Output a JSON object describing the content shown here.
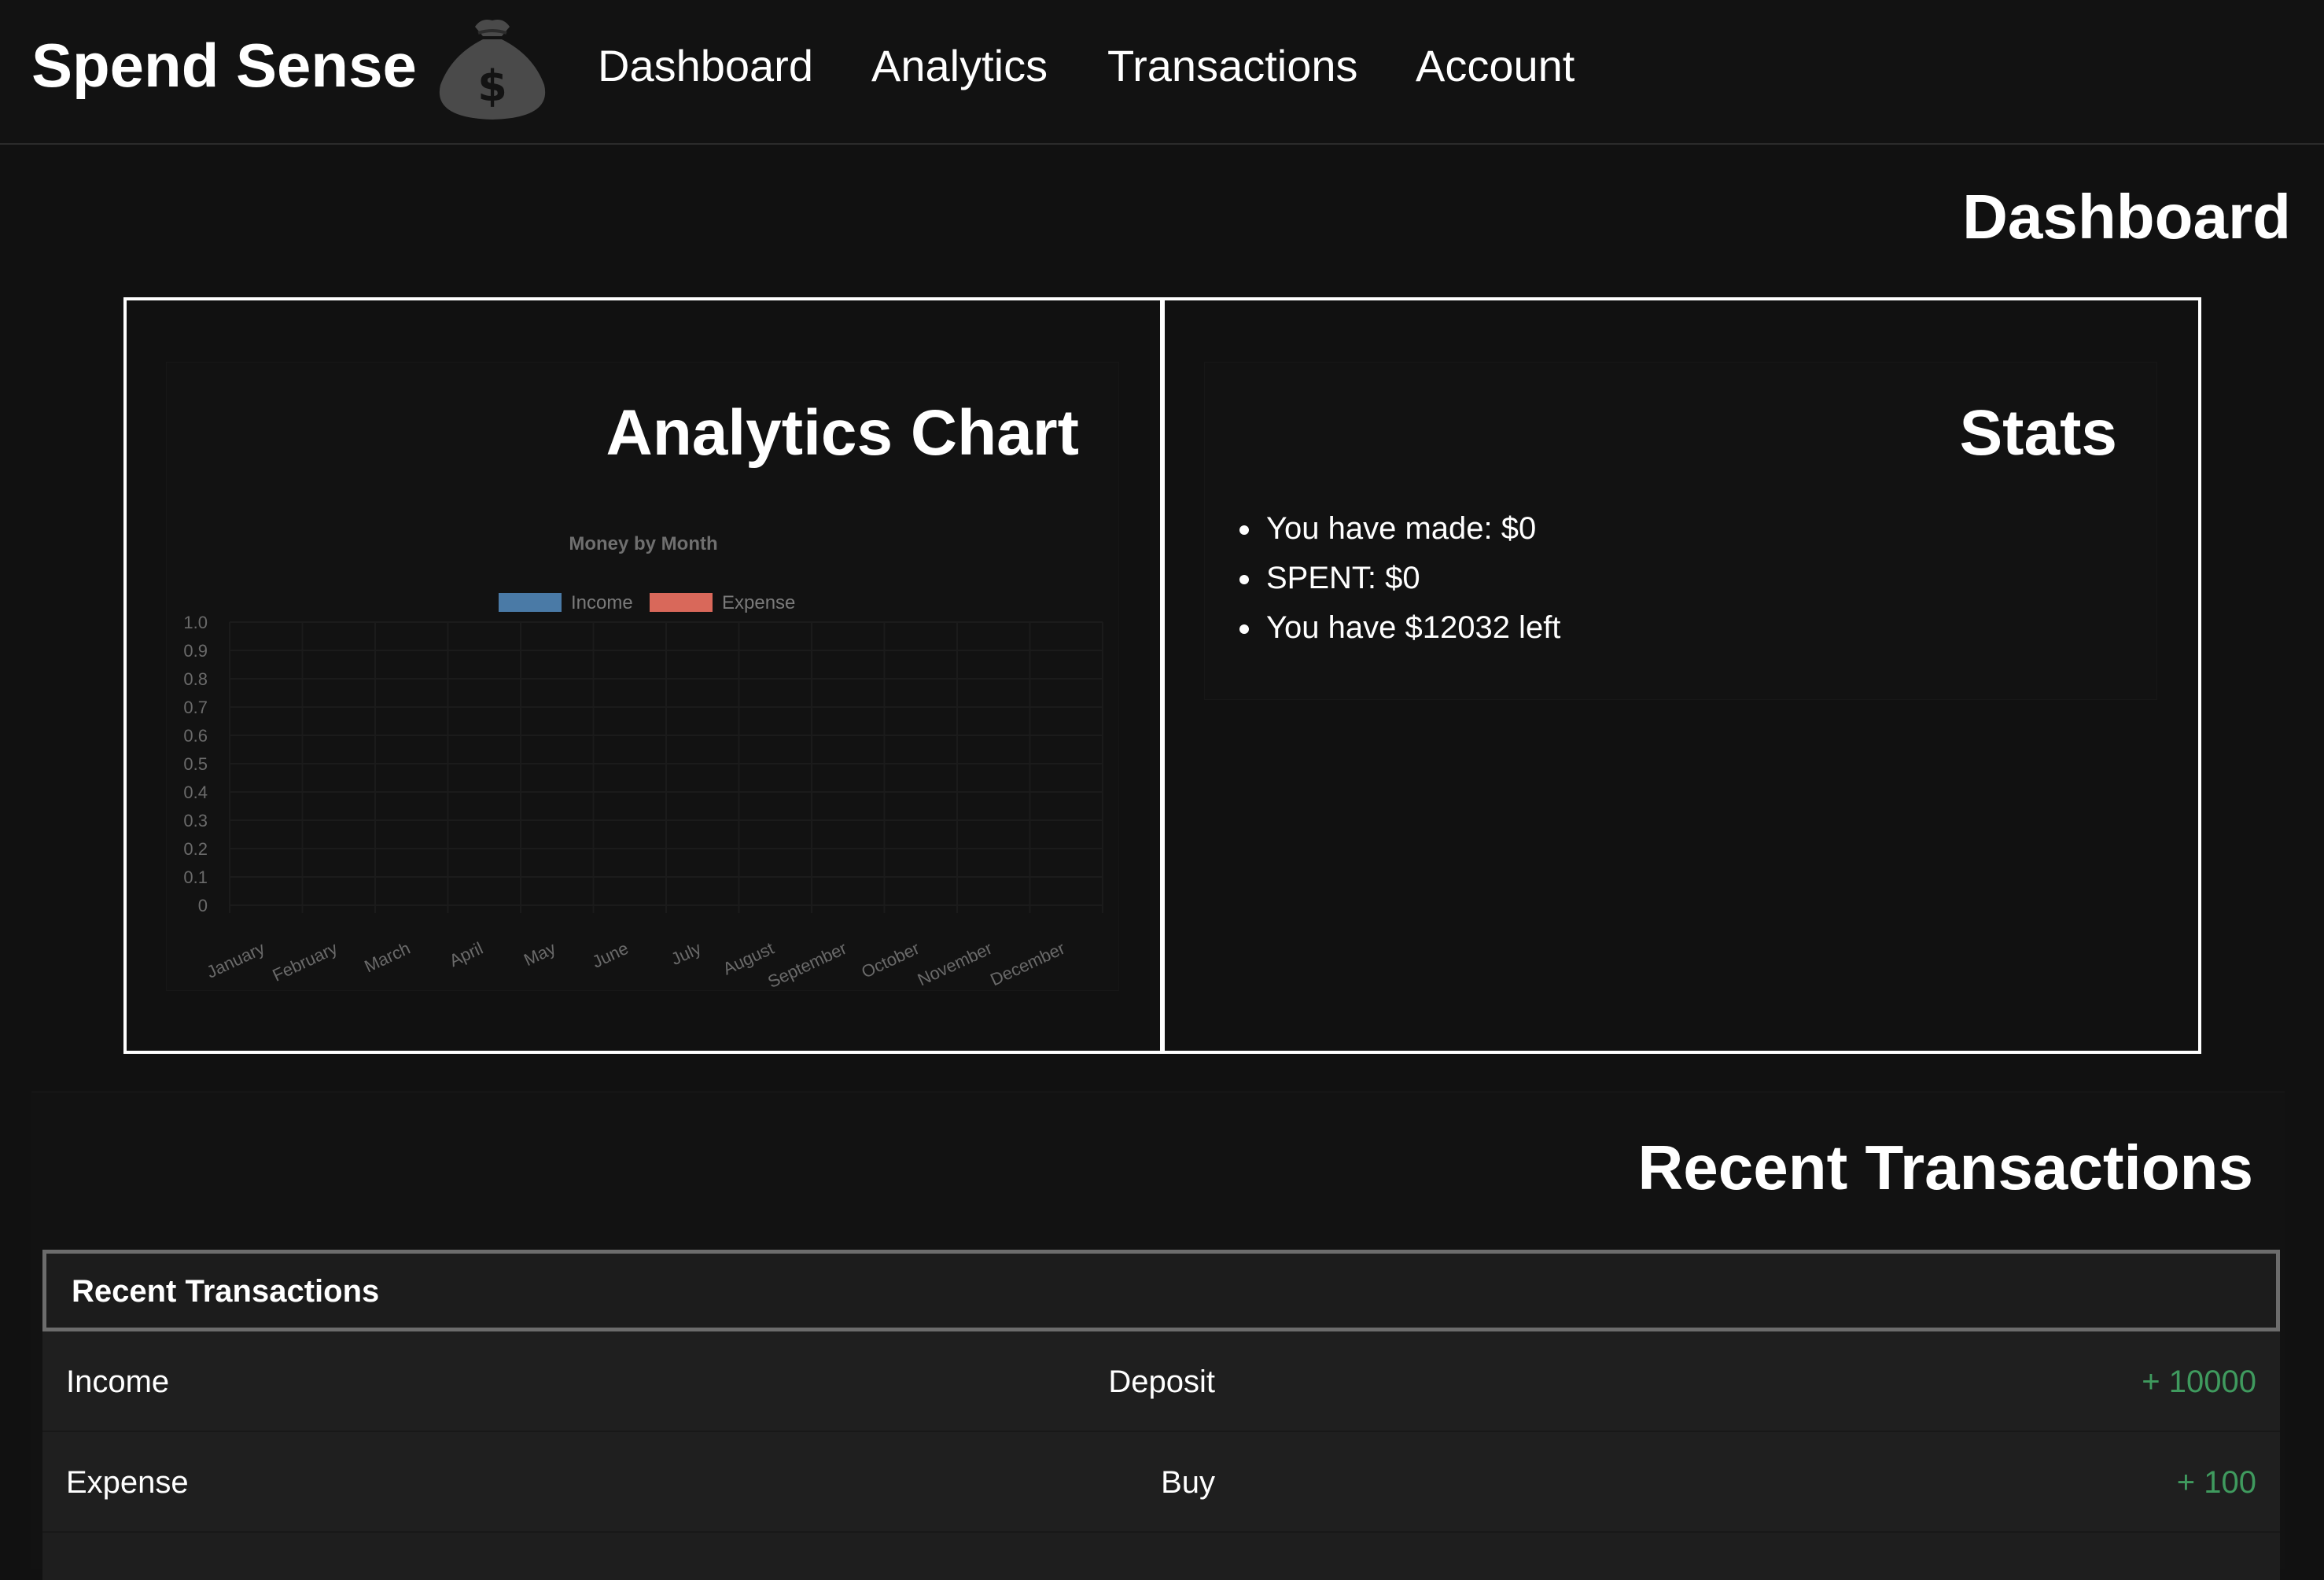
{
  "nav": {
    "brand": "Spend Sense",
    "links": [
      "Dashboard",
      "Analytics",
      "Transactions",
      "Account"
    ]
  },
  "page": {
    "title": "Dashboard"
  },
  "analytics_panel": {
    "title": "Analytics Chart"
  },
  "chart_data": {
    "type": "bar",
    "title": "Money by Month",
    "categories": [
      "January",
      "February",
      "March",
      "April",
      "May",
      "June",
      "July",
      "August",
      "September",
      "October",
      "November",
      "December"
    ],
    "series": [
      {
        "name": "Income",
        "color": "#4a7aa6",
        "values": [
          0,
          0,
          0,
          0,
          0,
          0,
          0,
          0,
          0,
          0,
          0,
          0
        ]
      },
      {
        "name": "Expense",
        "color": "#d9685a",
        "values": [
          0,
          0,
          0,
          0,
          0,
          0,
          0,
          0,
          0,
          0,
          0,
          0
        ]
      }
    ],
    "ylim": [
      0,
      1
    ],
    "yticks": [
      "0",
      "0.1",
      "0.2",
      "0.3",
      "0.4",
      "0.5",
      "0.6",
      "0.7",
      "0.8",
      "0.9",
      "1.0"
    ],
    "xlabel": "",
    "ylabel": "",
    "grid": true,
    "legend": "top"
  },
  "stats_panel": {
    "title": "Stats",
    "items": [
      "You have made: $0",
      "SPENT: $0",
      "You have $12032 left"
    ]
  },
  "recent": {
    "section_title": "Recent Transactions",
    "card_header": "Recent Transactions",
    "rows": [
      {
        "type": "Income",
        "description": "Deposit",
        "amount": "+ 10000"
      },
      {
        "type": "Expense",
        "description": "Buy",
        "amount": "+ 100"
      }
    ]
  },
  "colors": {
    "background": "#111111",
    "positive_amount": "#3f9a5e",
    "income_series": "#4a7aa6",
    "expense_series": "#d9685a"
  },
  "icons": {
    "brand": "money-bag-icon"
  }
}
